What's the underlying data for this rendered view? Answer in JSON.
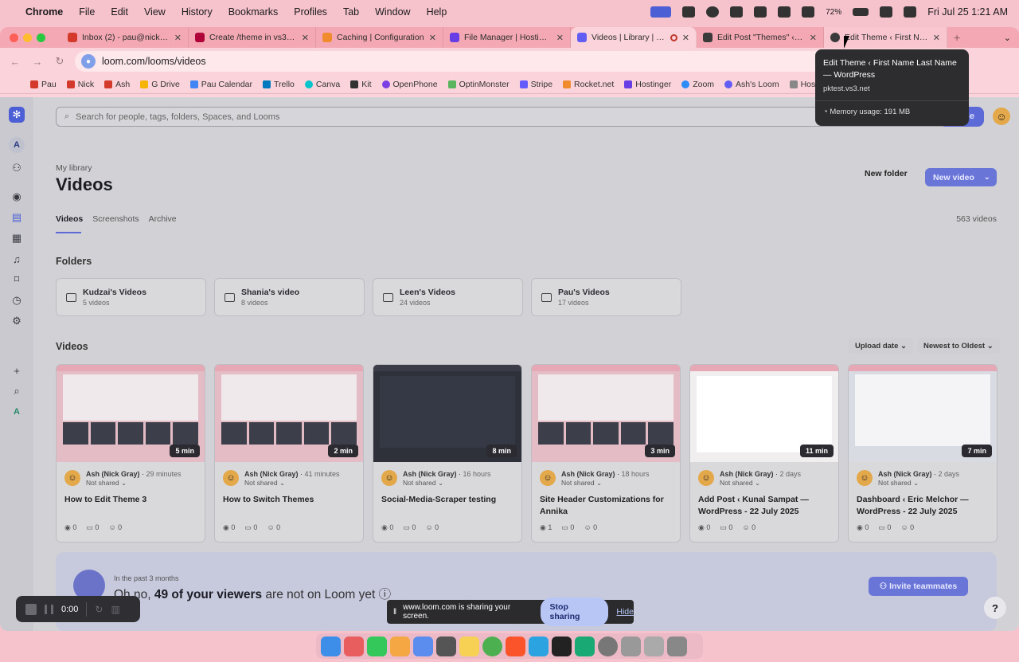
{
  "menubar": {
    "items": [
      "Chrome",
      "File",
      "Edit",
      "View",
      "History",
      "Bookmarks",
      "Profiles",
      "Tab",
      "Window",
      "Help"
    ],
    "battery": "72%",
    "datetime": "Fri Jul 25  1:21 AM"
  },
  "tabs": [
    {
      "label": "Inbox (2) - pau@nickgray",
      "color": "#d33a2c"
    },
    {
      "label": "Create /theme in vs3.net",
      "color": "#b0003a"
    },
    {
      "label": "Caching | Configuration",
      "color": "#f08c2e"
    },
    {
      "label": "File Manager | Hostinger",
      "color": "#673de6"
    },
    {
      "label": "Videos | Library | Loom",
      "color": "#625df5"
    },
    {
      "label": "Edit Post \"Themes\" ‹ vs3",
      "color": "#3a3a3a"
    },
    {
      "label": "Edit Theme ‹ First Name",
      "color": "#3a3a3a"
    }
  ],
  "url": "loom.com/looms/videos",
  "bookmarks": [
    "Pau",
    "Nick",
    "Ash",
    "G Drive",
    "Pau Calendar",
    "Trello",
    "Canva",
    "Kit",
    "OpenPhone",
    "OptinMonster",
    "Stripe",
    "Rocket.net",
    "Hostinger",
    "Zoom",
    "Ash's Loom",
    "Hostinger"
  ],
  "search": {
    "placeholder": "Search for people, tags, folders, Spaces, and Looms"
  },
  "record_label": "de",
  "library_label": "My library",
  "page_title": "Videos",
  "new_folder": "New folder",
  "new_video": "New video",
  "lib_tabs": [
    "Videos",
    "Screenshots",
    "Archive"
  ],
  "video_count": "563 videos",
  "folders_heading": "Folders",
  "folders": [
    {
      "name": "Kudzai's Videos",
      "count": "5 videos"
    },
    {
      "name": "Shania's video",
      "count": "8 videos"
    },
    {
      "name": "Leen's Videos",
      "count": "24 videos"
    },
    {
      "name": "Pau's Videos",
      "count": "17 videos"
    }
  ],
  "videos_heading": "Videos",
  "sort": {
    "field": "Upload date",
    "order": "Newest to Oldest"
  },
  "videos": [
    {
      "duration": "5 min",
      "author": "Ash (Nick Gray)",
      "ago": "29 minutes",
      "shared": "Not shared",
      "title": "How to Edit Theme 3",
      "views": "0",
      "comments": "0",
      "reactions": "0"
    },
    {
      "duration": "2 min",
      "author": "Ash (Nick Gray)",
      "ago": "41 minutes",
      "shared": "Not shared",
      "title": "How to Switch Themes",
      "views": "0",
      "comments": "0",
      "reactions": "0"
    },
    {
      "duration": "8 min",
      "author": "Ash (Nick Gray)",
      "ago": "16 hours",
      "shared": "Not shared",
      "title": "Social-Media-Scraper testing",
      "views": "0",
      "comments": "0",
      "reactions": "0"
    },
    {
      "duration": "3 min",
      "author": "Ash (Nick Gray)",
      "ago": "18 hours",
      "shared": "Not shared",
      "title": "Site Header Customizations for Annika",
      "views": "1",
      "comments": "0",
      "reactions": "0"
    },
    {
      "duration": "11 min",
      "author": "Ash (Nick Gray)",
      "ago": "2 days",
      "shared": "Not shared",
      "title": "Add Post ‹ Kunal Sampat — WordPress - 22 July 2025",
      "views": "0",
      "comments": "0",
      "reactions": "0"
    },
    {
      "duration": "7 min",
      "author": "Ash (Nick Gray)",
      "ago": "2 days",
      "shared": "Not shared",
      "title": "Dashboard ‹ Eric Melchor — WordPress - 22 July 2025",
      "views": "0",
      "comments": "0",
      "reactions": "0"
    }
  ],
  "banner": {
    "past": "In the past 3 months",
    "msg_pre": "Oh no, ",
    "msg_bold": "49 of your viewers",
    "msg_post": " are not on Loom yet ⓘ",
    "invite": "Invite teammates"
  },
  "recorder": {
    "time": "0:00"
  },
  "sharebar": {
    "text": "www.loom.com is sharing your screen.",
    "stop": "Stop sharing",
    "hide": "Hide"
  },
  "tooltip": {
    "title": "Edit Theme ‹ First Name Last Name — WordPress",
    "host": "pktest.vs3.net",
    "memory": "Memory usage: 191 MB"
  },
  "help": "?"
}
